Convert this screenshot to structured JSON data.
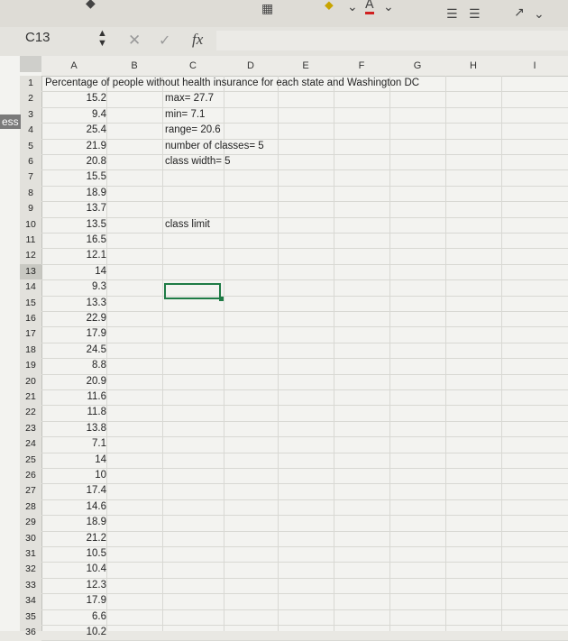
{
  "formula_bar": {
    "name_box": "C13",
    "fx_label": "fx",
    "formula": ""
  },
  "toolbar_icons": [
    "increase-indent-icon",
    "decrease-indent-icon",
    "text-orientation-icon",
    "font-color-icon"
  ],
  "columns": [
    "A",
    "B",
    "C",
    "D",
    "E",
    "F",
    "G",
    "H",
    "I"
  ],
  "rows": [
    "1",
    "2",
    "3",
    "4",
    "5",
    "6",
    "7",
    "8",
    "9",
    "10",
    "11",
    "12",
    "13",
    "14",
    "15",
    "16",
    "17",
    "18",
    "19",
    "20",
    "21",
    "22",
    "23",
    "24",
    "25",
    "26",
    "27",
    "28",
    "29",
    "30",
    "31",
    "32",
    "33",
    "34",
    "35",
    "36"
  ],
  "selected_row": "13",
  "row1_title": "Percentage of people without health insurance for each state and Washington DC",
  "column_b_values": [
    "15.2",
    "9.4",
    "25.4",
    "21.9",
    "20.8",
    "15.5",
    "18.9",
    "13.7",
    "13.5",
    "16.5",
    "12.1",
    "14",
    "9.3",
    "13.3",
    "22.9",
    "17.9",
    "24.5",
    "8.8",
    "20.9",
    "11.6",
    "11.8",
    "13.8",
    "7.1",
    "14",
    "10",
    "17.4",
    "14.6",
    "18.9",
    "21.2",
    "10.5",
    "10.4",
    "12.3",
    "17.9",
    "6.6",
    "10.2"
  ],
  "column_c_notes": {
    "r2": "max= 27.7",
    "r3": "min= 7.1",
    "r4": "range= 20.6",
    "r5": "number of classes= 5",
    "r6": "class width= 5",
    "r10": "class limit"
  },
  "left_edge_text": "ess"
}
